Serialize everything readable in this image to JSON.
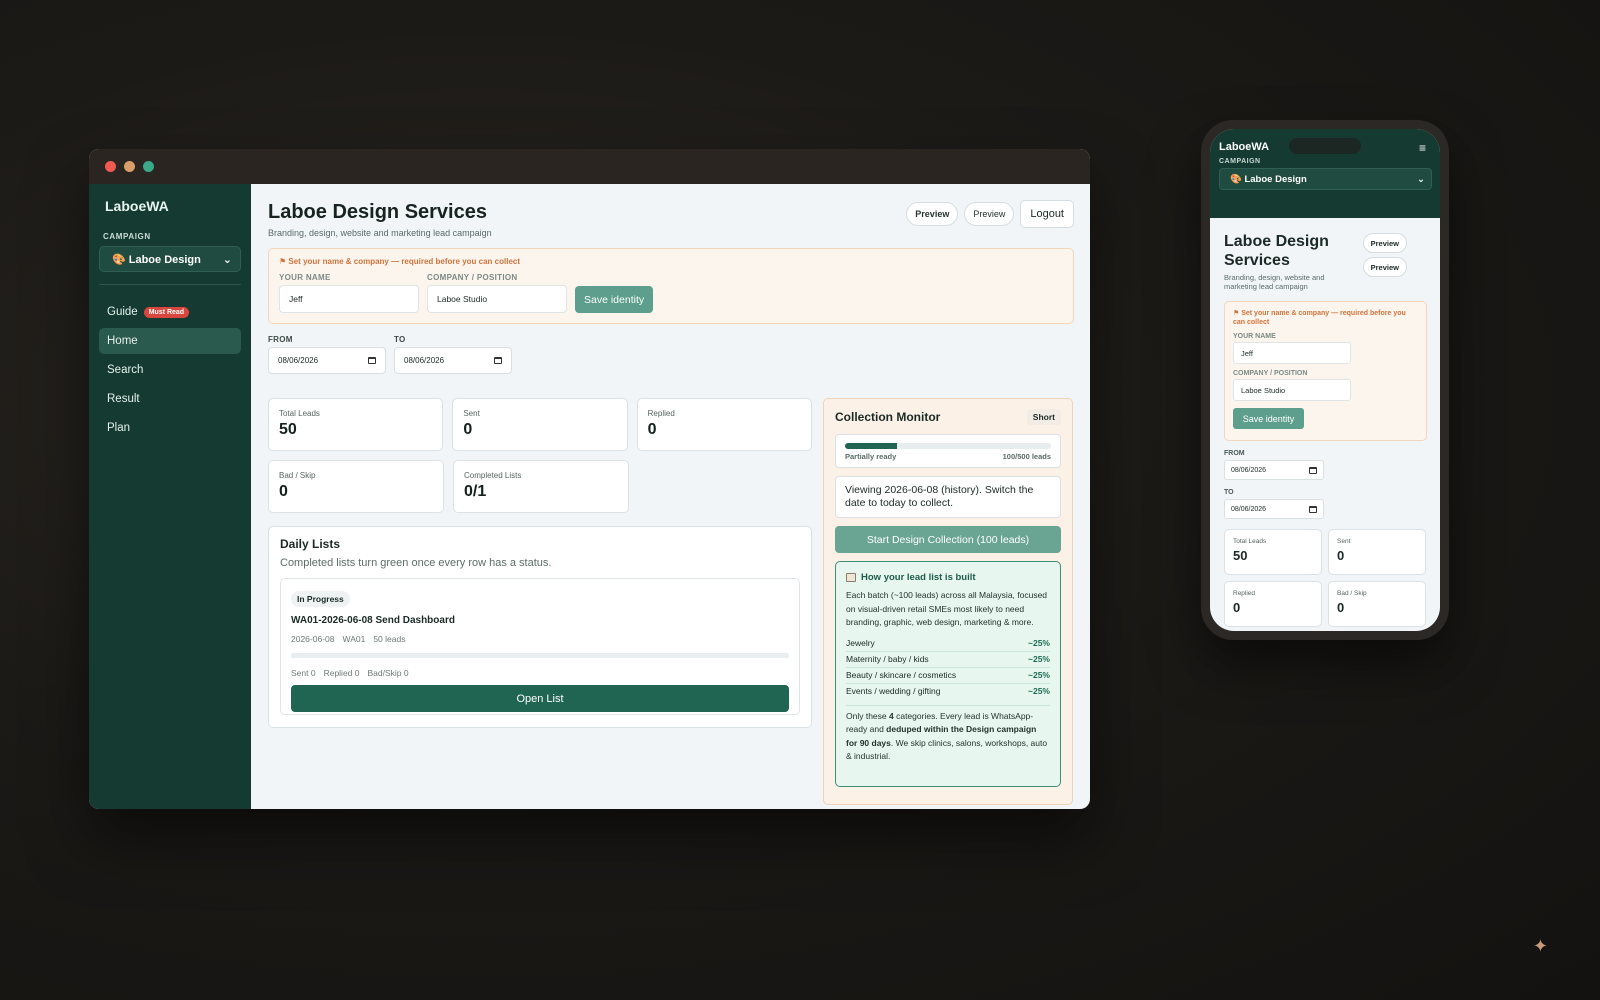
{
  "app": {
    "brand": "LaboeWA",
    "campaign_label": "CAMPAIGN",
    "campaign_value": "🎨 Laboe Design",
    "nav": [
      {
        "label": "Guide",
        "badge": "Must Read"
      },
      {
        "label": "Home"
      },
      {
        "label": "Search"
      },
      {
        "label": "Result"
      },
      {
        "label": "Plan"
      }
    ]
  },
  "header": {
    "title": "Laboe Design Services",
    "subtitle": "Branding, design, website and marketing lead campaign",
    "preview1": "Preview",
    "preview2": "Preview",
    "logout": "Logout"
  },
  "identity": {
    "warning": "⚑ Set your name & company — required before you can collect",
    "name_label": "YOUR NAME",
    "name_value": "Jeff",
    "company_label": "COMPANY / POSITION",
    "company_value": "Laboe Studio",
    "save": "Save identity"
  },
  "dates": {
    "from_label": "FROM",
    "from_value": "08/06/2026",
    "to_label": "TO",
    "to_value": "08/06/2026"
  },
  "stats": [
    {
      "label": "Total Leads",
      "value": "50"
    },
    {
      "label": "Sent",
      "value": "0"
    },
    {
      "label": "Replied",
      "value": "0"
    },
    {
      "label": "Bad / Skip",
      "value": "0"
    },
    {
      "label": "Completed Lists",
      "value": "0/1"
    }
  ],
  "daily": {
    "title": "Daily Lists",
    "subtitle": "Completed lists turn green once every row has a status.",
    "status": "In Progress",
    "list_name": "WA01-2026-06-08 Send Dashboard",
    "meta_date": "2026-06-08",
    "meta_code": "WA01",
    "meta_leads": "50 leads",
    "sent": "Sent 0",
    "replied": "Replied 0",
    "badskip": "Bad/Skip 0",
    "open": "Open List"
  },
  "monitor": {
    "title": "Collection Monitor",
    "tag": "Short",
    "progress_fraction": 0.25,
    "progress_label": "Partially ready",
    "progress_count": "100/500 leads",
    "history": "Viewing 2026-06-08 (history). Switch the date to today to collect.",
    "start": "Start Design Collection (100 leads)",
    "how_title": "How your lead list is built",
    "how_body": "Each batch (~100 leads) across all Malaysia, focused on visual-driven retail SMEs most likely to need branding, graphic, web design, marketing & more.",
    "categories": [
      {
        "name": "Jewelry",
        "pct": "~25%"
      },
      {
        "name": "Maternity / baby / kids",
        "pct": "~25%"
      },
      {
        "name": "Beauty / skincare / cosmetics",
        "pct": "~25%"
      },
      {
        "name": "Events / wedding / gifting",
        "pct": "~25%"
      }
    ],
    "foot_a": "Only these ",
    "foot_b": "4",
    "foot_c": " categories. Every lead is WhatsApp-ready and ",
    "foot_d": "deduped within the Design campaign for 90 days",
    "foot_e": ". We skip clinics, salons, workshops, auto & industrial."
  },
  "phone": {
    "brand": "LaboeWA",
    "menu": "≡",
    "campaign_label": "CAMPAIGN",
    "campaign_value": "🎨 Laboe Design",
    "title": "Laboe Design Services",
    "subtitle": "Branding, design, website and marketing lead campaign",
    "preview1": "Preview",
    "preview2": "Preview",
    "warning": "⚑ Set your name & company — required before you can collect",
    "name_label": "YOUR NAME",
    "name_value": "Jeff",
    "company_label": "COMPANY / POSITION",
    "company_value": "Laboe Studio",
    "save": "Save identity",
    "from_label": "FROM",
    "from_value": "08/06/2026",
    "to_label": "TO",
    "to_value": "08/06/2026",
    "stats": [
      {
        "label": "Total Leads",
        "value": "50"
      },
      {
        "label": "Sent",
        "value": "0"
      },
      {
        "label": "Replied",
        "value": "0"
      },
      {
        "label": "Bad / Skip",
        "value": "0"
      }
    ]
  },
  "sparkle": "✦"
}
